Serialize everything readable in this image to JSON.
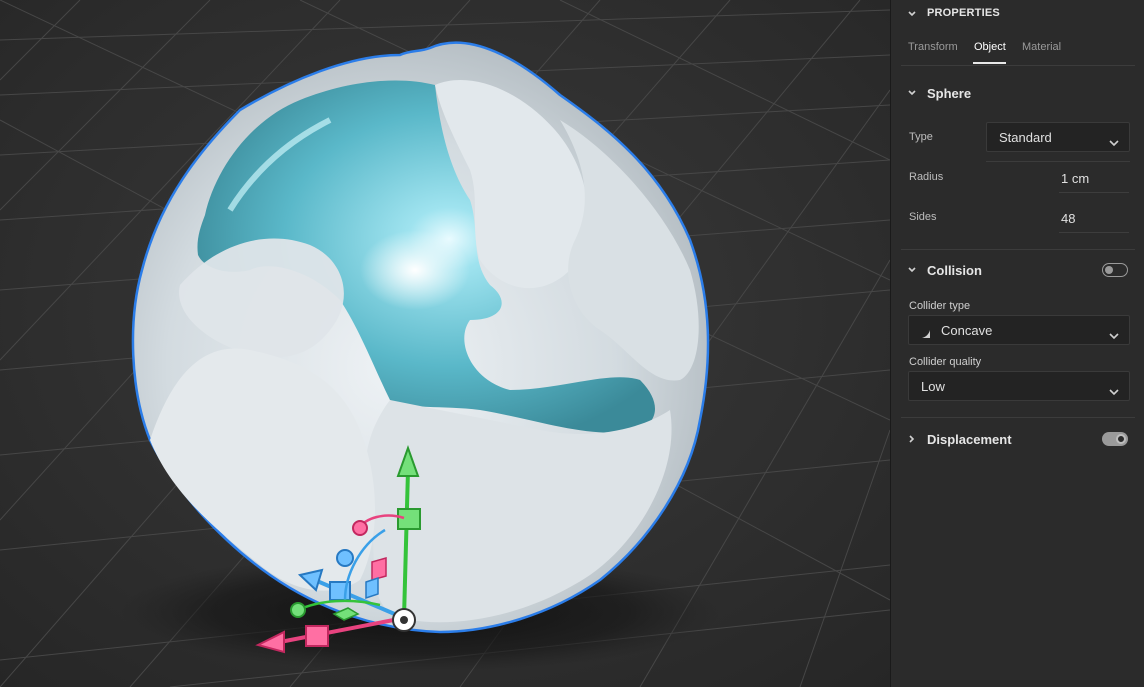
{
  "panel": {
    "properties_title": "PROPERTIES",
    "tabs": [
      {
        "label": "Transform",
        "active": false
      },
      {
        "label": "Object",
        "active": true
      },
      {
        "label": "Material",
        "active": false
      }
    ],
    "sphere": {
      "title": "Sphere",
      "type_label": "Type",
      "type_value": "Standard",
      "radius_label": "Radius",
      "radius_value": "1 cm",
      "sides_label": "Sides",
      "sides_value": "48"
    },
    "collision": {
      "title": "Collision",
      "enabled": false,
      "collider_type_label": "Collider type",
      "collider_type_value": "Concave",
      "collider_quality_label": "Collider quality",
      "collider_quality_value": "Low"
    },
    "displacement": {
      "title": "Displacement",
      "enabled": true
    }
  },
  "viewport": {
    "object": "snowball-sphere",
    "selection_outline_color": "#2b7de9",
    "gizmo_colors": {
      "x": "#e8437f",
      "y": "#34c33a",
      "z": "#3aa0e8"
    }
  }
}
